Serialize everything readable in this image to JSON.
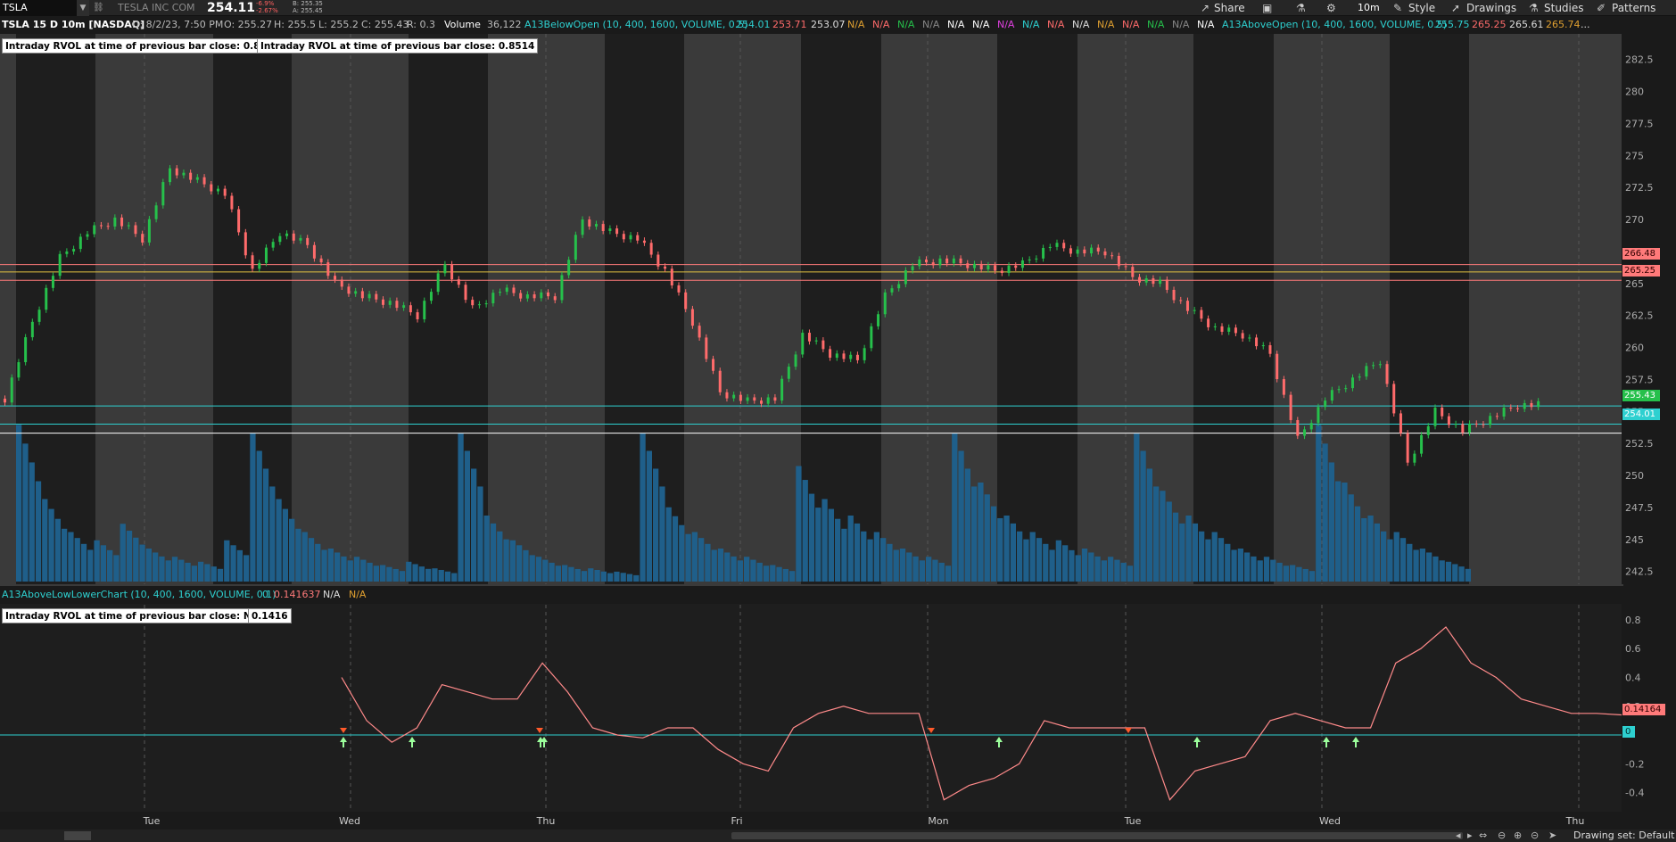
{
  "toolbar": {
    "symbol": "TSLA",
    "company_name": "TESLA INC COM",
    "last_price": "254.11",
    "change_points": "-6.9%",
    "change_percent": "-2.67%",
    "bid": "B: 255.35",
    "ask": "A: 255.45",
    "share": "Share",
    "timeframe": "10m",
    "style": "Style",
    "drawings": "Drawings",
    "studies": "Studies",
    "patterns": "Patterns",
    "colors": {
      "bg": "#262626",
      "up": "#26c04b",
      "down": "#ff6b6b"
    }
  },
  "chart_header": {
    "title": "TSLA 15 D 10m [NASDAQ]",
    "date": "D: 8/2/23, 7:50 PM",
    "open": "O: 255.27",
    "high": "H: 255.5",
    "low": "L: 255.2",
    "close": "C: 255.43",
    "range": "R: 0.3",
    "volume_label": "Volume",
    "volume_value": "36,122",
    "study1_name": "A13BelowOpen (10, 400, 1600, VOLUME, 0.5)",
    "study1_v1": "254.01",
    "study1_v2": "253.71",
    "study1_v3": "253.07",
    "na": "N/A",
    "study2_name": "A13AboveOpen (10, 400, 1600, VOLUME, 0.5)",
    "study2_v1": "255.75",
    "study2_v2": "265.25",
    "study2_v3": "265.61",
    "study2_v4": "265.74",
    "ellipsis": "..."
  },
  "labels": {
    "rvol_box_1": "Intraday RVOL at time of previous bar close: 0.8514",
    "rvol_box_2": "Intraday RVOL at time of previous bar close: 0.8514",
    "rvol_box_3": "Intraday RVOL at time of previous bar close: N/A",
    "rvol_value_3": "0.1416"
  },
  "study_header": {
    "name": "A13AboveLowLowerChart (10, 400, 1600, VOLUME, 0.1)",
    "v1": "0",
    "v2": "0.141637",
    "v3": "N/A",
    "v4": "N/A"
  },
  "price_tags": {
    "upper_red": "266.48",
    "upper_red2": "265.25",
    "last_green": "255.43",
    "cyan": "254.01"
  },
  "lower_tags": {
    "value": "0.14164",
    "zero": "0"
  },
  "status": {
    "drawing_set": "Drawing set: Default"
  },
  "chart_data": [
    {
      "type": "candlestick",
      "y_ticks": [
        "282.5",
        "280",
        "277.5",
        "275",
        "272.5",
        "270",
        "267.5",
        "265",
        "262.5",
        "260",
        "257.5",
        "255",
        "252.5",
        "250",
        "247.5",
        "245",
        "242.5"
      ],
      "ylim": [
        241.5,
        284.5
      ],
      "x_ticks": [
        "Tue",
        "Wed",
        "Thu",
        "Fri",
        "Mon",
        "Tue",
        "Wed",
        "Thu"
      ],
      "closes": [
        256,
        262,
        267,
        269,
        270,
        268.5,
        274,
        273,
        272,
        266,
        269,
        268,
        265,
        264,
        263.5,
        262.5,
        266.5,
        263,
        264.5,
        264,
        264,
        270,
        269,
        268.5,
        266,
        262,
        256.5,
        255.8,
        256,
        261,
        259.5,
        259,
        264,
        266.5,
        266.8,
        266.5,
        266,
        266.5,
        268,
        267.5,
        267.5,
        265.5,
        265,
        263,
        261.5,
        261,
        259.5,
        252.8,
        256,
        257.5,
        259,
        251,
        255,
        253.5,
        254.5,
        255.5
      ],
      "volumes": [
        0.95,
        0.5,
        0.3,
        0.25,
        0.35,
        0.2,
        0.15,
        0.12,
        0.25,
        0.9,
        0.5,
        0.3,
        0.2,
        0.15,
        0.1,
        0.12,
        0.08,
        0.9,
        0.4,
        0.25,
        0.15,
        0.1,
        0.08,
        0.06,
        0.9,
        0.45,
        0.3,
        0.2,
        0.15,
        0.1,
        0.7,
        0.5,
        0.4,
        0.3,
        0.2,
        0.15,
        0.9,
        0.6,
        0.4,
        0.3,
        0.25,
        0.2,
        0.15,
        0.9,
        0.55,
        0.4,
        0.3,
        0.2,
        0.15,
        0.1,
        0.95,
        0.6,
        0.4,
        0.3,
        0.2,
        0.12
      ],
      "levels": [
        {
          "value": 266.48,
          "color": "#ff7a7a"
        },
        {
          "value": 265.9,
          "color": "#e0c040"
        },
        {
          "value": 265.25,
          "color": "#ff7a7a"
        },
        {
          "value": 255.43,
          "color": "#2ed0d0"
        },
        {
          "value": 254.01,
          "color": "#2ed0d0"
        },
        {
          "value": 253.3,
          "color": "#ffffff"
        }
      ]
    },
    {
      "type": "line",
      "y_ticks": [
        "0.8",
        "0.6",
        "0.4",
        "0.2",
        "-0.2",
        "-0.4"
      ],
      "ylim": [
        -0.52,
        0.88
      ],
      "values": [
        0.4,
        0.1,
        -0.05,
        0.05,
        0.35,
        0.3,
        0.25,
        0.25,
        0.5,
        0.3,
        0.05,
        0.0,
        -0.02,
        0.05,
        0.05,
        -0.1,
        -0.2,
        -0.25,
        0.05,
        0.15,
        0.2,
        0.15,
        0.15,
        0.15,
        -0.45,
        -0.35,
        -0.3,
        -0.2,
        0.1,
        0.05,
        0.05,
        0.05,
        0.05,
        -0.45,
        -0.25,
        -0.2,
        -0.15,
        0.1,
        0.15,
        0.1,
        0.05,
        0.05,
        0.5,
        0.6,
        0.75,
        0.5,
        0.4,
        0.25,
        0.2,
        0.15,
        0.15,
        0.14
      ],
      "series": [
        {
          "name": "A13AboveLowLowerChart",
          "color": "#ff8a8a"
        }
      ],
      "zero_line_color": "#2ed0d0"
    }
  ]
}
